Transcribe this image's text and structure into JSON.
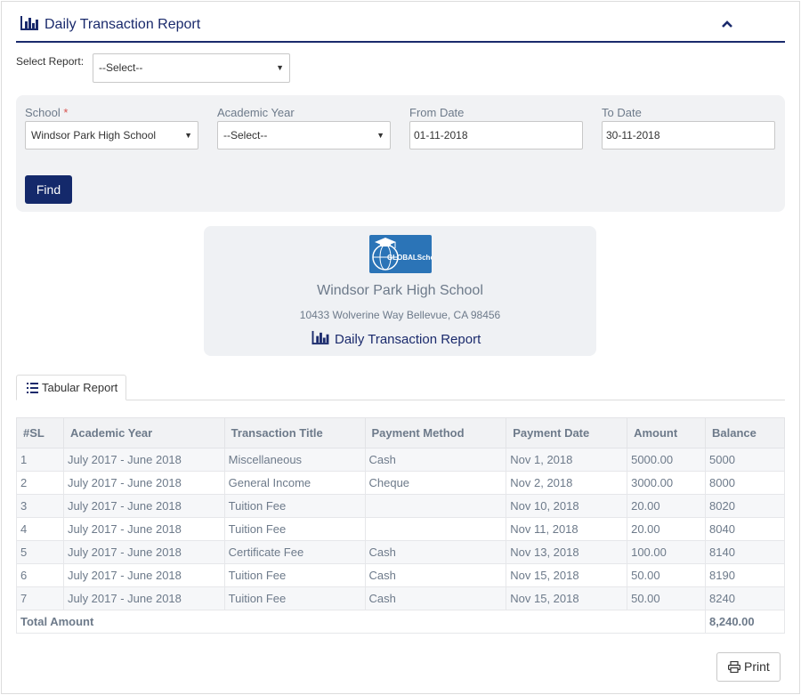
{
  "header": {
    "title": "Daily Transaction Report",
    "icon": "bar-chart-icon",
    "collapse_icon": "chevron-up-icon",
    "accent_color": "#1a2a6c"
  },
  "select_report": {
    "label": "Select Report:",
    "value": "--Select--"
  },
  "filters": {
    "school_label": "School",
    "required_mark": "*",
    "school_value": "Windsor Park High School",
    "academic_year_label": "Academic Year",
    "academic_year_value": "--Select--",
    "from_date_label": "From Date",
    "from_date_value": "01-11-2018",
    "to_date_label": "To Date",
    "to_date_value": "30-11-2018",
    "find_label": "Find"
  },
  "report_header": {
    "logo_text": "GLOBALSchool",
    "school_name": "Windsor Park High School",
    "address": "10433 Wolverine Way Bellevue, CA 98456",
    "title": "Daily Transaction Report"
  },
  "tabs": [
    {
      "label": "Tabular Report",
      "icon": "list-icon"
    }
  ],
  "table": {
    "columns": [
      "#SL",
      "Academic Year",
      "Transaction Title",
      "Payment Method",
      "Payment Date",
      "Amount",
      "Balance"
    ],
    "rows": [
      [
        "1",
        "July 2017 - June 2018",
        "Miscellaneous",
        "Cash",
        "Nov 1, 2018",
        "5000.00",
        "5000"
      ],
      [
        "2",
        "July 2017 - June 2018",
        "General Income",
        "Cheque",
        "Nov 2, 2018",
        "3000.00",
        "8000"
      ],
      [
        "3",
        "July 2017 - June 2018",
        "Tuition Fee",
        "",
        "Nov 10, 2018",
        "20.00",
        "8020"
      ],
      [
        "4",
        "July 2017 - June 2018",
        "Tuition Fee",
        "",
        "Nov 11, 2018",
        "20.00",
        "8040"
      ],
      [
        "5",
        "July 2017 - June 2018",
        "Certificate Fee",
        "Cash",
        "Nov 13, 2018",
        "100.00",
        "8140"
      ],
      [
        "6",
        "July 2017 - June 2018",
        "Tuition Fee",
        "Cash",
        "Nov 15, 2018",
        "50.00",
        "8190"
      ],
      [
        "7",
        "July 2017 - June 2018",
        "Tuition Fee",
        "Cash",
        "Nov 15, 2018",
        "50.00",
        "8240"
      ]
    ],
    "total_label": "Total Amount",
    "total_value": "8,240.00"
  },
  "print": {
    "label": "Print",
    "icon": "printer-icon"
  }
}
